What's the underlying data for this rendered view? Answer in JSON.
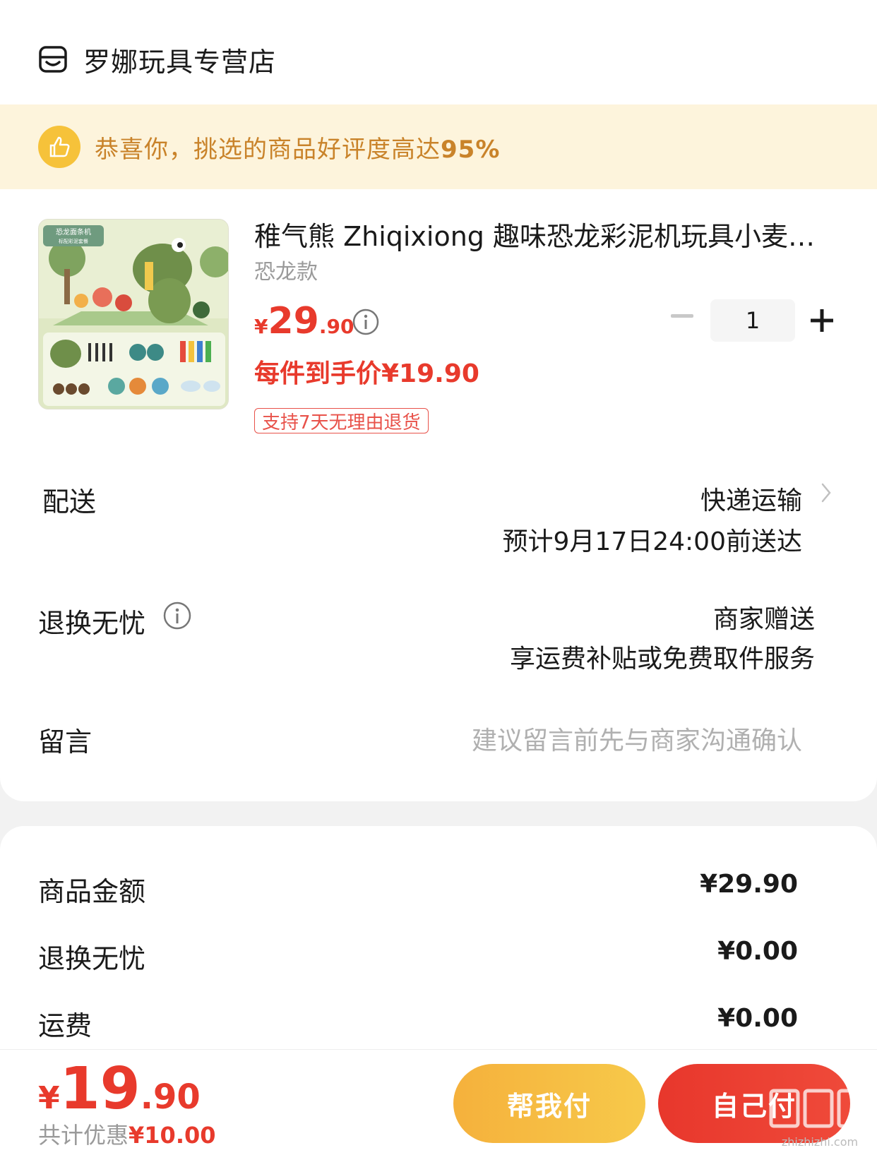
{
  "store": {
    "name": "罗娜玩具专营店",
    "icon": "store-icon"
  },
  "banner": {
    "text": "恭喜你，挑选的商品好评度高达",
    "percent": "95%",
    "icon": "thumbs-up-icon"
  },
  "product": {
    "title": "稚气熊 Zhiqixiong 趣味恐龙彩泥机玩具小麦…",
    "variant": "恐龙款",
    "price_symbol": "¥",
    "price_int": "29",
    "price_dec": ".90",
    "per_item": "每件到手价¥19.90",
    "return_tag": "支持7天无理由退货",
    "quantity": "1",
    "image_texts": {
      "header": "恐龙面条机",
      "sub": "标配彩泥套餐"
    }
  },
  "delivery": {
    "label": "配送",
    "method": "快递运输",
    "eta": "预计9月17日24:00前送达"
  },
  "returns": {
    "label": "退换无忧",
    "line1": "商家赠送",
    "line2": "享运费补贴或免费取件服务"
  },
  "message": {
    "label": "留言",
    "placeholder": "建议留言前先与商家沟通确认"
  },
  "summary": [
    {
      "label": "商品金额",
      "value": "¥29.90"
    },
    {
      "label": "退换无忧",
      "value": "¥0.00"
    },
    {
      "label": "运费",
      "value": "¥0.00"
    }
  ],
  "footer": {
    "total_symbol": "¥",
    "total_int": "19",
    "total_dec": ".90",
    "discount_label": "共计优惠",
    "discount_value": "¥10.00",
    "help_pay": "帮我付",
    "self_pay": "自己付",
    "watermark_text": "zhizhizhi.com"
  },
  "colors": {
    "accent_red": "#e83a2c",
    "banner_bg": "#fdf4dc",
    "banner_text": "#c9832a",
    "help_btn": "#f5b13c"
  }
}
